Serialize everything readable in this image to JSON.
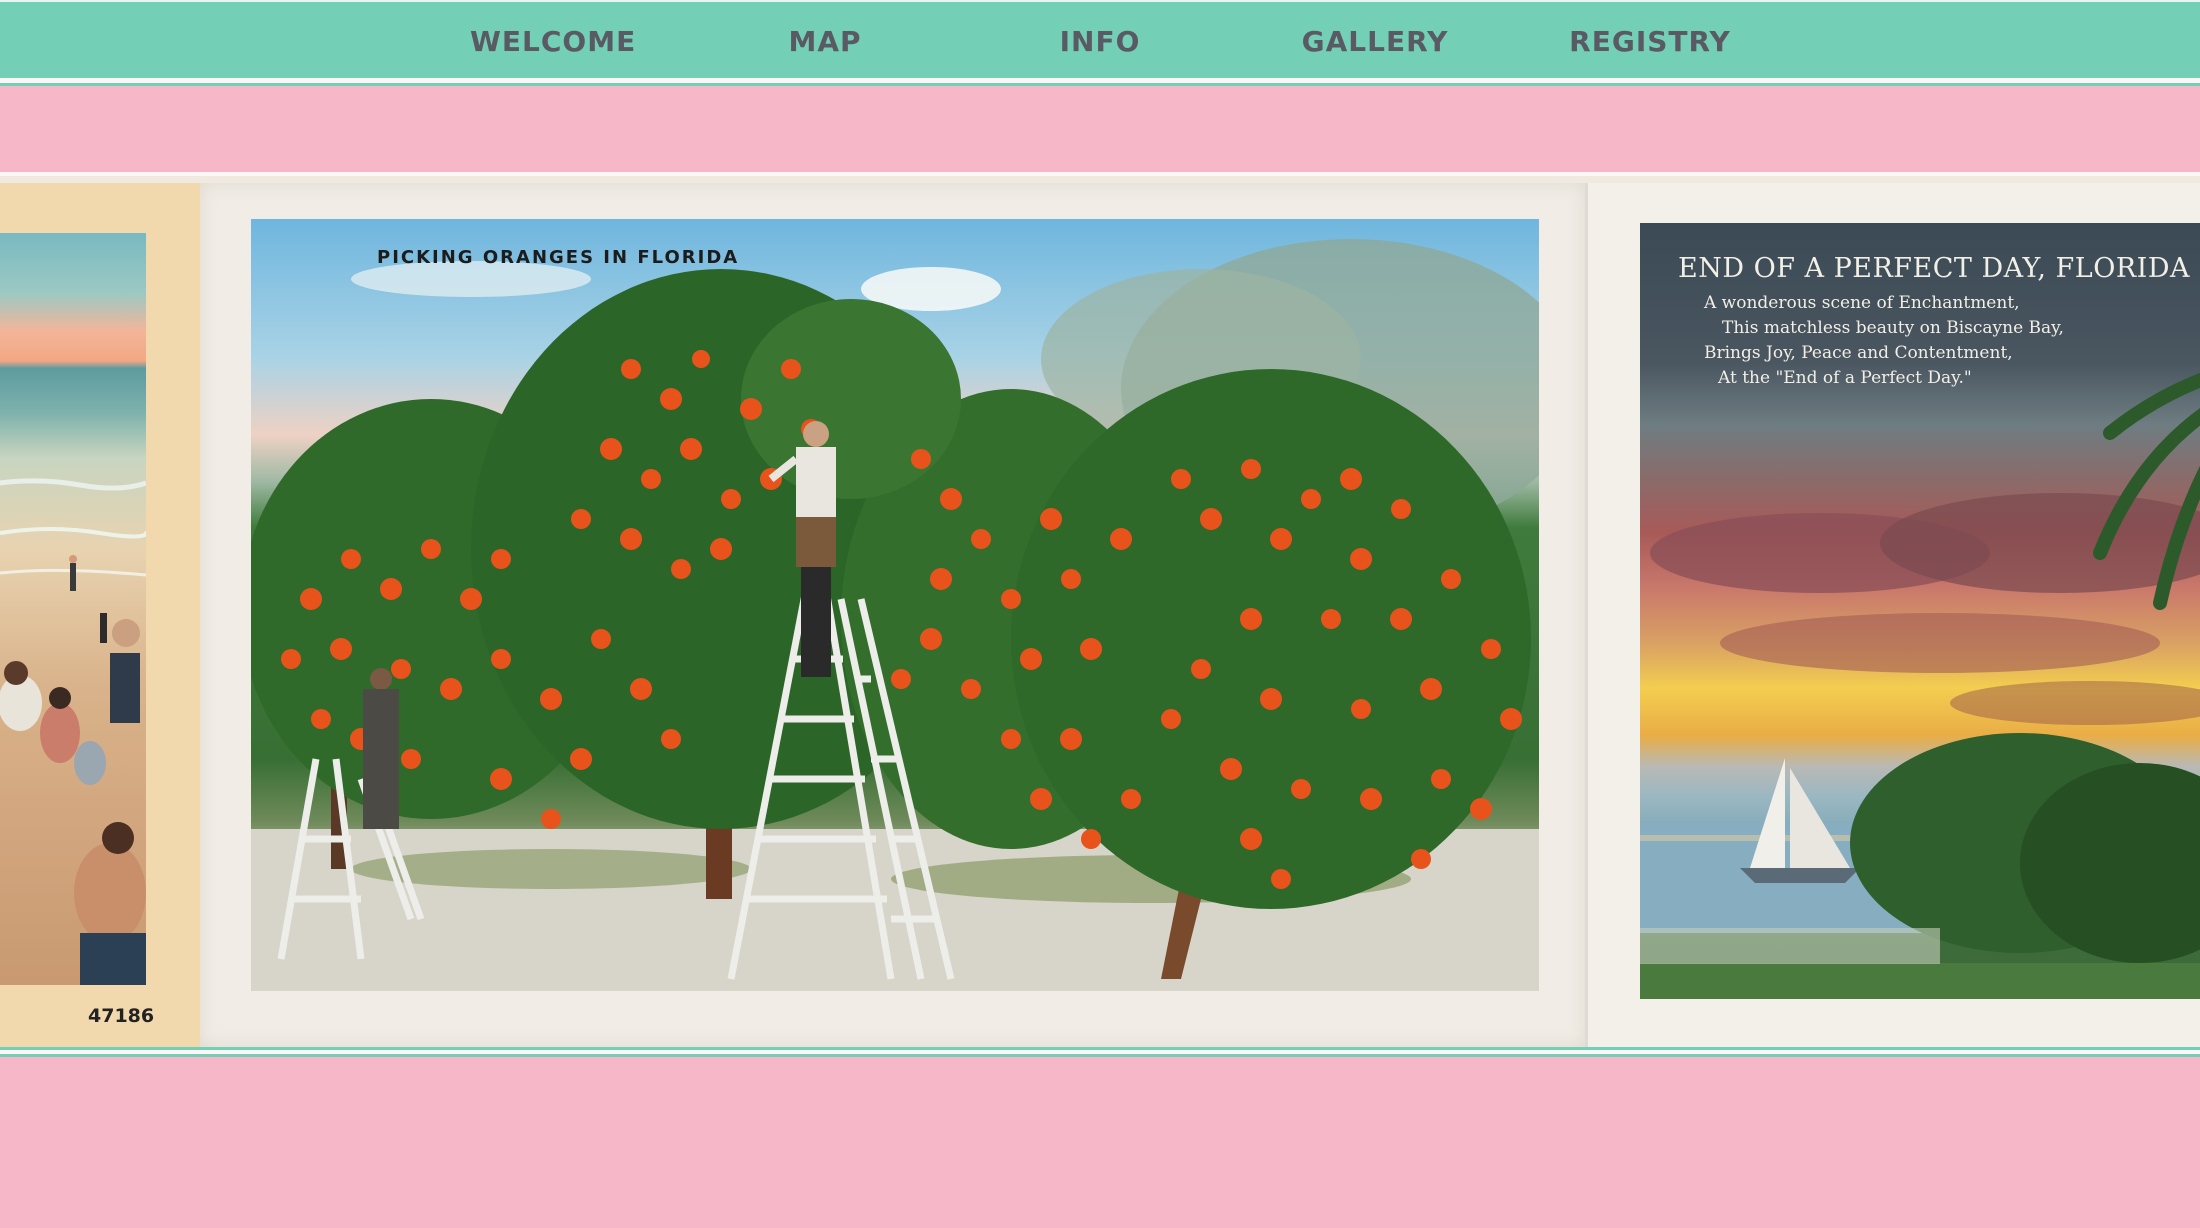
{
  "nav": {
    "items": [
      {
        "label": "WELCOME"
      },
      {
        "label": "MAP"
      },
      {
        "label": "INFO"
      },
      {
        "label": "GALLERY"
      },
      {
        "label": "REGISTRY"
      }
    ]
  },
  "gallery": {
    "left_card": {
      "number": "47186"
    },
    "center_card": {
      "caption": "PICKING ORANGES IN FLORIDA"
    },
    "right_card": {
      "title": "END OF A PERFECT DAY, FLORIDA",
      "verse": [
        "A wonderous scene of Enchantment,",
        "This matchless beauty on Biscayne Bay,",
        "Brings Joy, Peace and Contentment,",
        "At the \"End of a Perfect Day.\""
      ]
    }
  },
  "colors": {
    "nav_background": "#73d0b6",
    "nav_text": "#5a5a65",
    "page_background": "#f6b7c8",
    "rule_white": "#fbf7f7"
  }
}
